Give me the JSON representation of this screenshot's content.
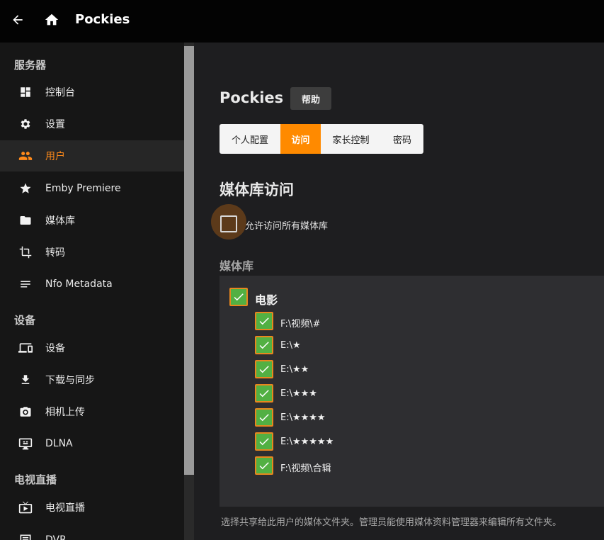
{
  "header": {
    "title": "Pockies"
  },
  "sidebar": {
    "sections": [
      {
        "title": "服务器"
      },
      {
        "title": "设备"
      },
      {
        "title": "电视直播"
      }
    ],
    "items": [
      {
        "label": "控制台",
        "icon": "dashboard-icon"
      },
      {
        "label": "设置",
        "icon": "gear-icon"
      },
      {
        "label": "用户",
        "icon": "users-icon",
        "active": true
      },
      {
        "label": "Emby Premiere",
        "icon": "star-icon"
      },
      {
        "label": "媒体库",
        "icon": "folder-icon"
      },
      {
        "label": "转码",
        "icon": "crop-icon"
      },
      {
        "label": "Nfo Metadata",
        "icon": "list-icon"
      },
      {
        "label": "设备",
        "icon": "devices-icon"
      },
      {
        "label": "下载与同步",
        "icon": "download-icon"
      },
      {
        "label": "相机上传",
        "icon": "camera-icon"
      },
      {
        "label": "DLNA",
        "icon": "dlna-icon"
      },
      {
        "label": "电视直播",
        "icon": "tv-icon"
      },
      {
        "label": "DVR",
        "icon": "dvr-icon"
      }
    ]
  },
  "main": {
    "title": "Pockies",
    "help_label": "帮助",
    "tabs": [
      {
        "label": "个人配置"
      },
      {
        "label": "访问",
        "active": true
      },
      {
        "label": "家长控制"
      },
      {
        "label": "密码"
      }
    ],
    "section_title": "媒体库访问",
    "allow_all_label": "允许访问所有媒体库",
    "allow_all_checked": false,
    "library_title": "媒体库",
    "library": {
      "name": "电影",
      "checked": true,
      "folders": [
        {
          "path": "F:\\视频\\#",
          "checked": true
        },
        {
          "path": "E:\\★",
          "checked": true
        },
        {
          "path": "E:\\★★",
          "checked": true
        },
        {
          "path": "E:\\★★★",
          "checked": true
        },
        {
          "path": "E:\\★★★★",
          "checked": true
        },
        {
          "path": "E:\\★★★★★",
          "checked": true
        },
        {
          "path": "F:\\视频\\合辑",
          "checked": true
        }
      ]
    },
    "footer_note": "选择共享给此用户的媒体文件夹。管理员能使用媒体资料管理器来编辑所有文件夹。"
  },
  "colors": {
    "accent": "#ff8a00",
    "check_fill": "#52b043",
    "check_border": "#e8871e"
  }
}
